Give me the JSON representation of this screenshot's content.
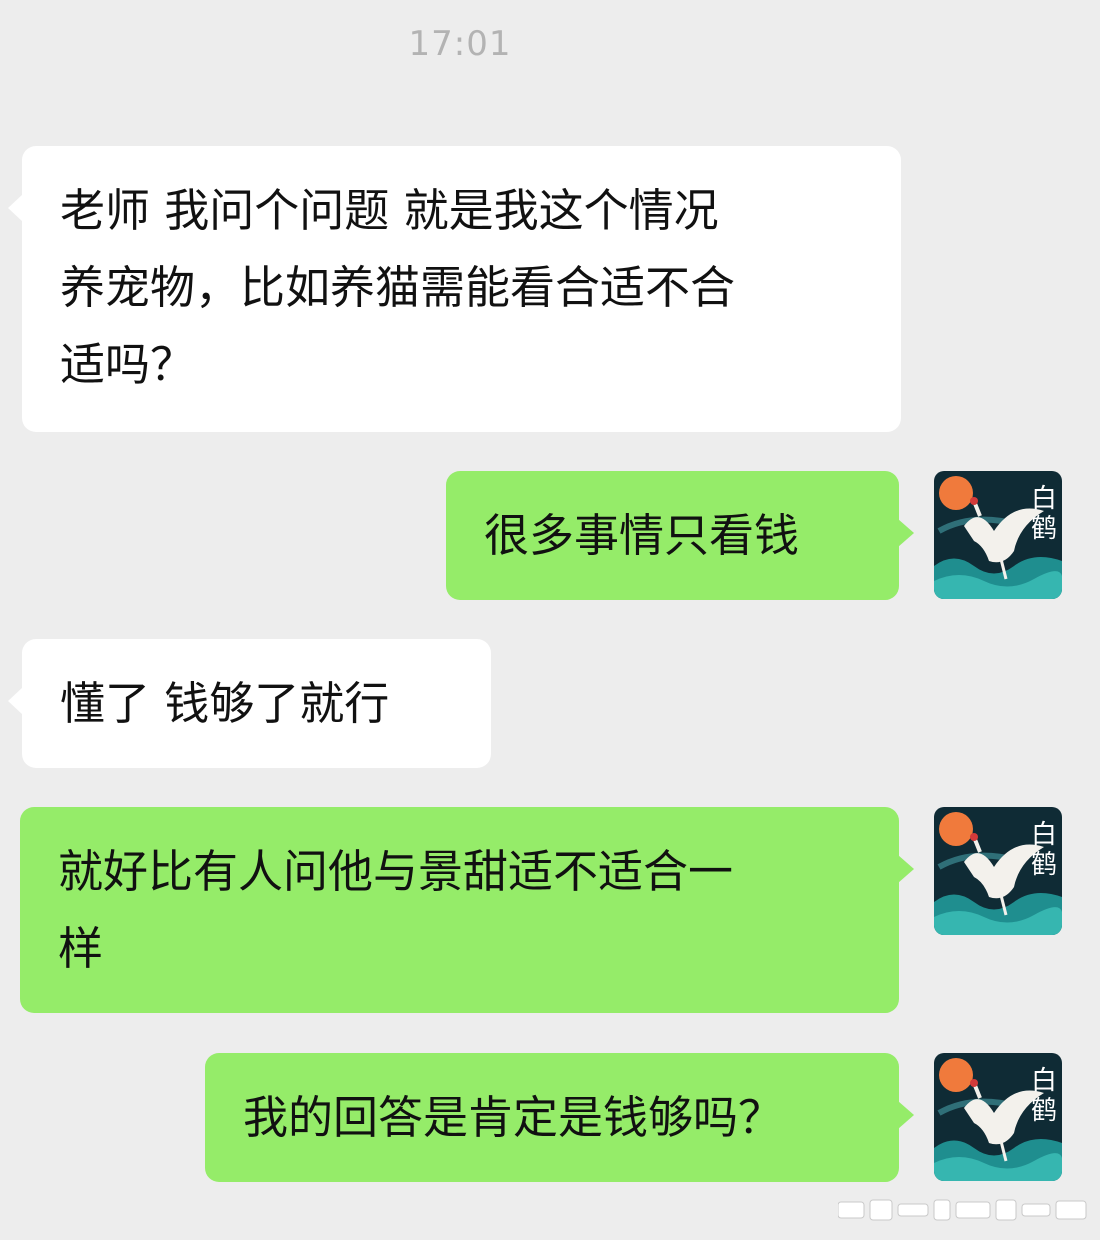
{
  "chat": {
    "timestamp": "17:01",
    "messages": [
      {
        "direction": "incoming",
        "text": "老师 我问个问题 就是我这个情况\n养宠物，比如养猫需能看合适不合\n适吗？"
      },
      {
        "direction": "outgoing",
        "text": "很多事情只看钱"
      },
      {
        "direction": "incoming",
        "text": "懂了 钱够了就行"
      },
      {
        "direction": "outgoing",
        "text": "就好比有人问他与景甜适不适合一\n样"
      },
      {
        "direction": "outgoing",
        "text": "我的回答是肯定是钱够吗？"
      }
    ]
  },
  "avatar": {
    "label_line1": "白",
    "label_line2": "鹤",
    "icon": "crane-avatar-icon"
  },
  "colors": {
    "background": "#ededed",
    "incoming_bubble": "#ffffff",
    "outgoing_bubble": "#95ec69",
    "timestamp_text": "#b3b3b3"
  }
}
